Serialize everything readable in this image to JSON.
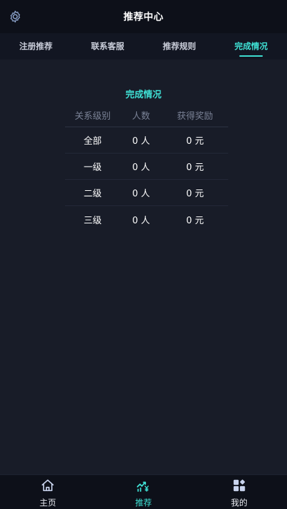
{
  "header": {
    "title": "推荐中心",
    "settings_icon": "gear-icon"
  },
  "tabs": [
    {
      "label": "注册推荐",
      "active": false
    },
    {
      "label": "联系客服",
      "active": false
    },
    {
      "label": "推荐规则",
      "active": false
    },
    {
      "label": "完成情况",
      "active": true
    }
  ],
  "summary": {
    "title": "完成情况",
    "columns": [
      "关系级别",
      "人数",
      "获得奖励"
    ],
    "rows": [
      {
        "level": "全部",
        "count": "0 人",
        "reward": "0 元"
      },
      {
        "level": "一级",
        "count": "0 人",
        "reward": "0 元"
      },
      {
        "level": "二级",
        "count": "0 人",
        "reward": "0 元"
      },
      {
        "level": "三级",
        "count": "0 人",
        "reward": "0 元"
      }
    ]
  },
  "bottom_nav": [
    {
      "label": "主页",
      "icon": "home-icon",
      "active": false
    },
    {
      "label": "推荐",
      "icon": "trend-yuan-icon",
      "active": true
    },
    {
      "label": "我的",
      "icon": "grid-apps-icon",
      "active": false
    }
  ],
  "colors": {
    "accent": "#3fe0d4",
    "background": "#181c28",
    "header": "#0d1019"
  }
}
